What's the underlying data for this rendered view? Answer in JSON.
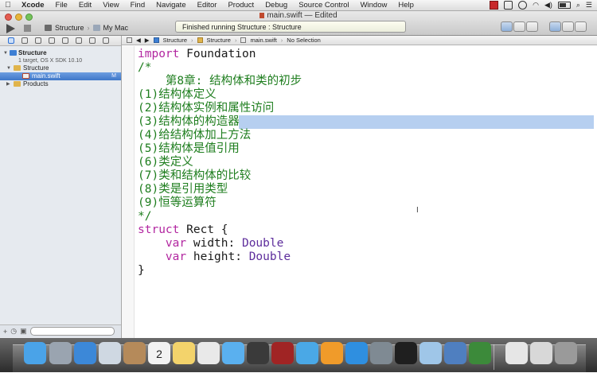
{
  "menubar": {
    "apple": "",
    "items": [
      "Xcode",
      "File",
      "Edit",
      "View",
      "Find",
      "Navigate",
      "Editor",
      "Product",
      "Debug",
      "Source Control",
      "Window",
      "Help"
    ]
  },
  "window": {
    "title": "main.swift — Edited",
    "scheme": {
      "target": "Structure",
      "destination": "My Mac"
    },
    "activity": "Finished running Structure : Structure"
  },
  "navigator": {
    "project": {
      "name": "Structure",
      "subtitle": "1 target, OS X SDK 10.10"
    },
    "group": "Structure",
    "file": {
      "name": "main.swift",
      "badge": "M"
    },
    "products": "Products"
  },
  "jumpbar": {
    "crumbs": [
      "Structure",
      "Structure",
      "main.swift",
      "No Selection"
    ]
  },
  "code": {
    "l1": {
      "kw": "import",
      "rest": " Foundation"
    },
    "l2": "/*",
    "l3": "    第8章: 结构体和类的初步",
    "l4": "(1)结构体定义",
    "l5": "(2)结构体实例和属性访问",
    "l6": "(3)结构体的构造器",
    "l7": "(4)给结构体加上方法",
    "l8": "(5)结构体是值引用",
    "l9": "(6)类定义",
    "l10": "(7)类和结构体的比较",
    "l11": "(8)类是引用类型",
    "l12": "(9)恒等运算符",
    "l13": "*/",
    "l14": {
      "kw": "struct",
      "rest": " Rect {"
    },
    "l15": {
      "indent": "    ",
      "kw": "var",
      "name": " width: ",
      "type": "Double"
    },
    "l16": {
      "indent": "    ",
      "kw": "var",
      "name": " height: ",
      "type": "Double"
    },
    "l17": "}"
  },
  "colors": {
    "keyword": "#b226a0",
    "type": "#5e2e9c",
    "comment": "#1d7d1d",
    "selection": "#b6cff0"
  },
  "dock": {
    "apps": [
      "finder-icon",
      "launchpad-icon",
      "safari-icon",
      "mail-icon",
      "contacts-icon",
      "calendar-icon",
      "notes-icon",
      "reminders-icon",
      "messages-icon",
      "facetime-icon",
      "photo-booth-icon",
      "itunes-icon",
      "ibooks-icon",
      "app-store-icon",
      "system-preferences-icon",
      "terminal-icon",
      "preview-icon",
      "xcode-icon",
      "camtasia-icon",
      "documents-icon",
      "downloads-icon",
      "trash-icon"
    ],
    "calendar_day": "2"
  }
}
